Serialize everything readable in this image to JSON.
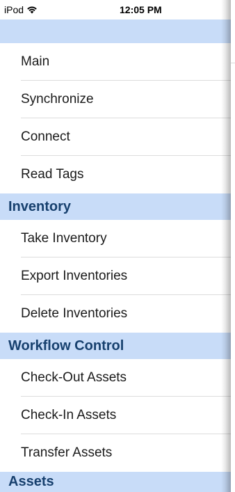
{
  "status_bar": {
    "device": "iPod",
    "wifi_icon": "wifi-icon",
    "time": "12:05 PM"
  },
  "colors": {
    "section_background": "#c8dcf8",
    "section_text": "#17406e",
    "item_text": "#1a1a1a",
    "separator": "#dcdcdc"
  },
  "menu": {
    "general_items": [
      {
        "label": "Main"
      },
      {
        "label": "Synchronize"
      },
      {
        "label": "Connect"
      },
      {
        "label": "Read Tags"
      }
    ],
    "sections": [
      {
        "title": "Inventory",
        "items": [
          {
            "label": "Take Inventory"
          },
          {
            "label": "Export Inventories"
          },
          {
            "label": "Delete Inventories"
          }
        ]
      },
      {
        "title": "Workflow Control",
        "items": [
          {
            "label": "Check-Out Assets"
          },
          {
            "label": "Check-In Assets"
          },
          {
            "label": "Transfer Assets"
          }
        ]
      },
      {
        "title": "Assets",
        "items": []
      }
    ]
  }
}
